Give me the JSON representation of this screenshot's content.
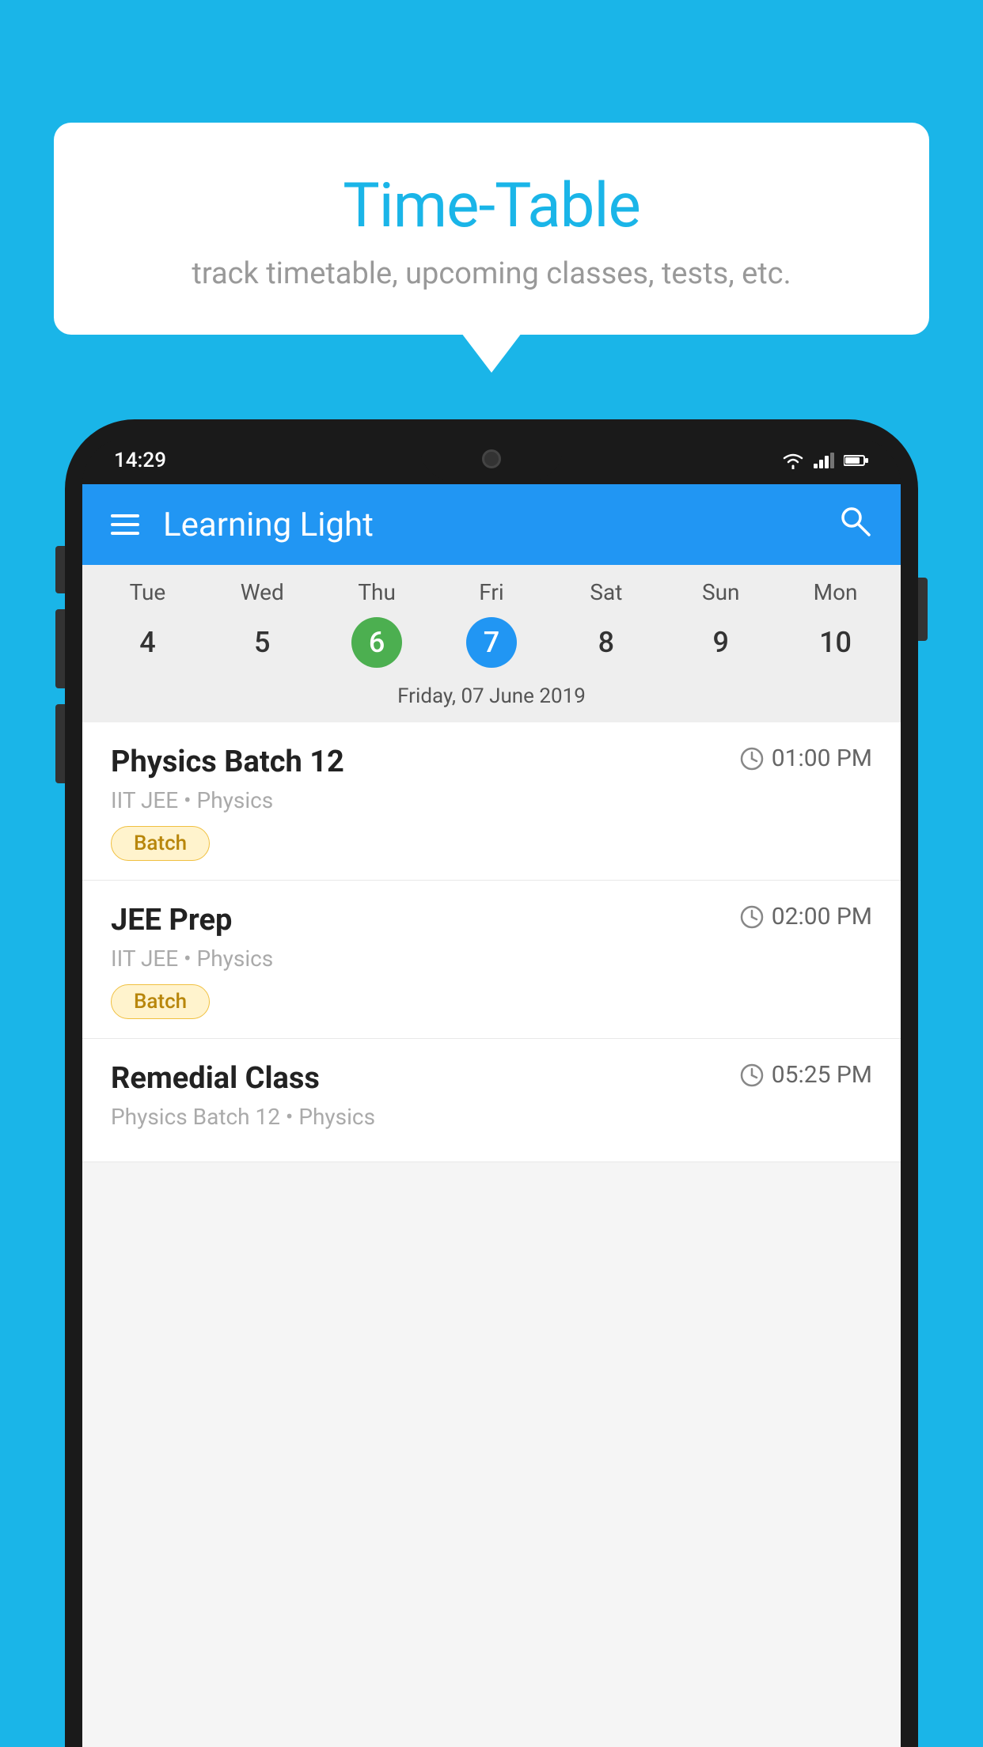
{
  "background_color": "#1ab5e8",
  "speech_bubble": {
    "title": "Time-Table",
    "subtitle": "track timetable, upcoming classes, tests, etc."
  },
  "phone": {
    "status_bar": {
      "time": "14:29",
      "wifi": true,
      "signal": true,
      "battery": true
    },
    "header": {
      "app_name": "Learning Light",
      "menu_label": "menu",
      "search_label": "search"
    },
    "calendar": {
      "days": [
        "Tue",
        "Wed",
        "Thu",
        "Fri",
        "Sat",
        "Sun",
        "Mon"
      ],
      "dates": [
        "4",
        "5",
        "6",
        "7",
        "8",
        "9",
        "10"
      ],
      "today_index": 2,
      "selected_index": 3,
      "selected_date_label": "Friday, 07 June 2019"
    },
    "classes": [
      {
        "name": "Physics Batch 12",
        "time": "01:00 PM",
        "meta": "IIT JEE • Physics",
        "tag": "Batch"
      },
      {
        "name": "JEE Prep",
        "time": "02:00 PM",
        "meta": "IIT JEE • Physics",
        "tag": "Batch"
      },
      {
        "name": "Remedial Class",
        "time": "05:25 PM",
        "meta": "Physics Batch 12 • Physics",
        "tag": ""
      }
    ]
  }
}
